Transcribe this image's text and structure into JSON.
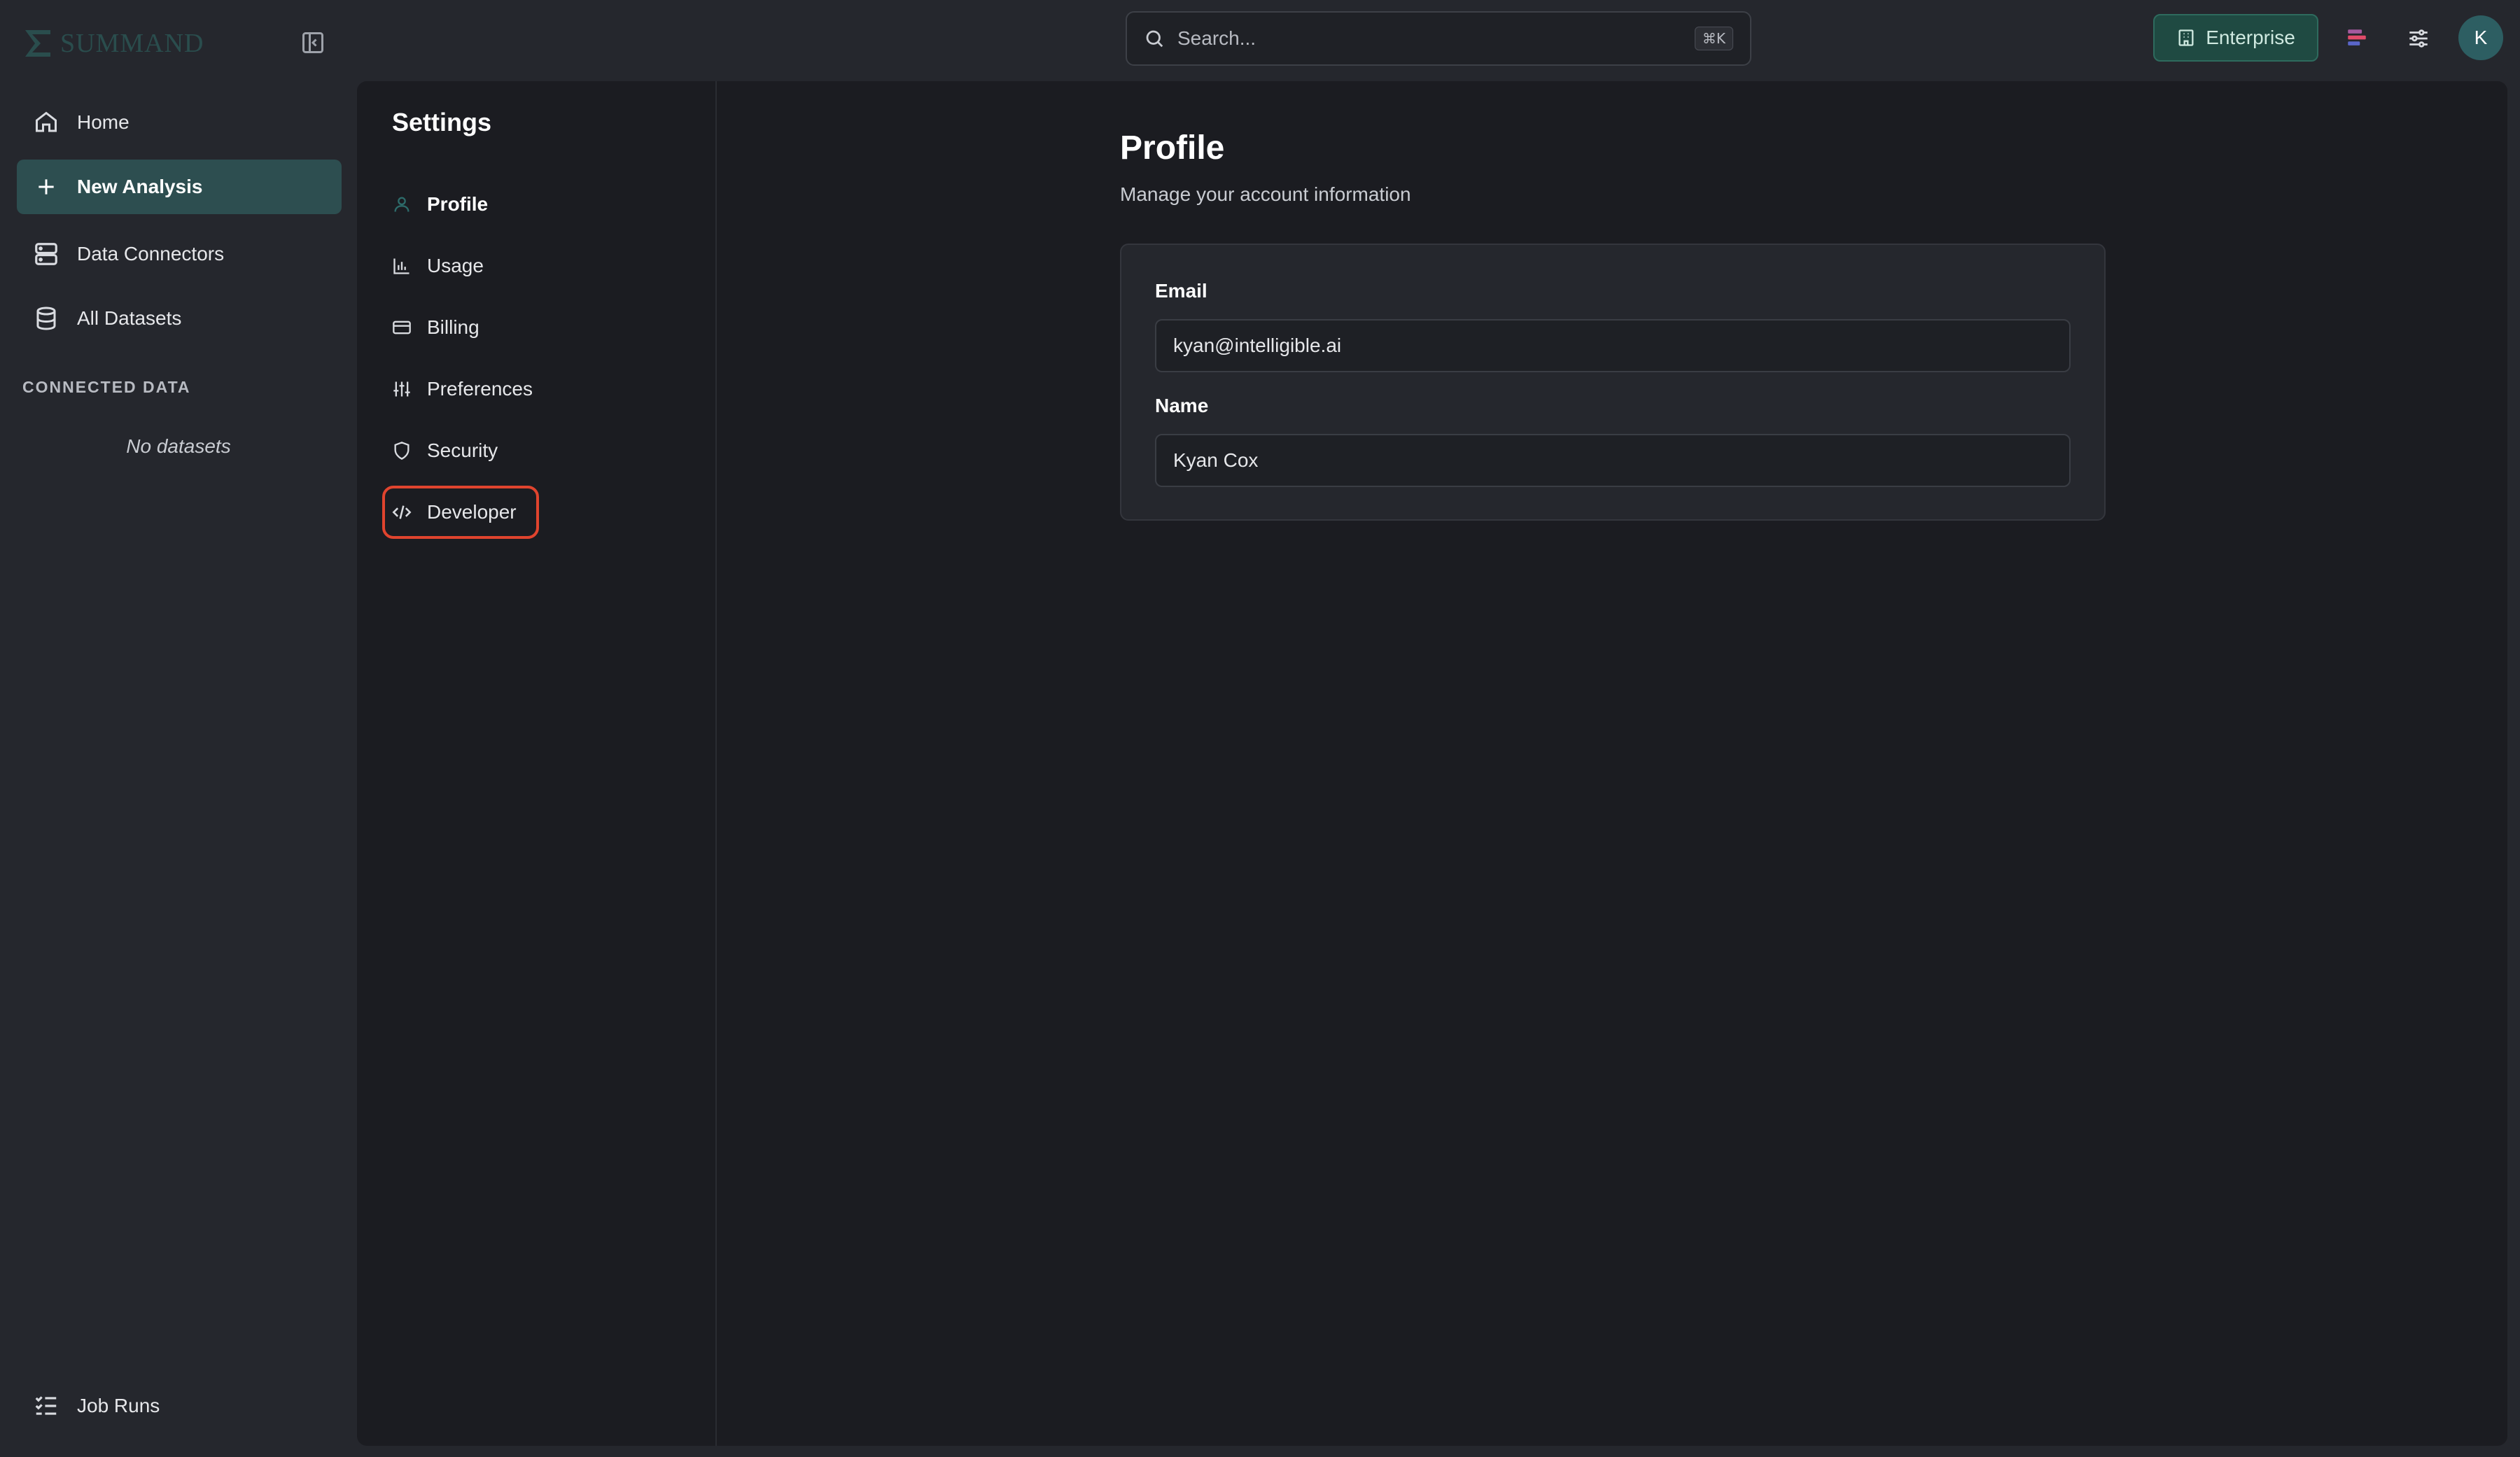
{
  "brand": {
    "name": "SUMMAND",
    "color": "#2a4d4d"
  },
  "sidebar": {
    "items": [
      {
        "label": "Home",
        "icon": "home-icon"
      },
      {
        "label": "New Analysis",
        "icon": "plus-icon",
        "active": true
      },
      {
        "label": "Data Connectors",
        "icon": "server-icon"
      },
      {
        "label": "All Datasets",
        "icon": "database-icon"
      }
    ],
    "section_label": "CONNECTED DATA",
    "empty_text": "No datasets",
    "footer_item": {
      "label": "Job Runs",
      "icon": "list-checks-icon"
    }
  },
  "topbar": {
    "search_placeholder": "Search...",
    "search_shortcut": "⌘K",
    "enterprise_label": "Enterprise",
    "avatar_initial": "K"
  },
  "settings": {
    "title": "Settings",
    "items": [
      {
        "label": "Profile",
        "icon": "user-icon",
        "active": true
      },
      {
        "label": "Usage",
        "icon": "bar-chart-icon"
      },
      {
        "label": "Billing",
        "icon": "credit-card-icon"
      },
      {
        "label": "Preferences",
        "icon": "sliders-icon"
      },
      {
        "label": "Security",
        "icon": "shield-icon"
      },
      {
        "label": "Developer",
        "icon": "code-icon",
        "highlighted": true
      }
    ]
  },
  "profile": {
    "title": "Profile",
    "subtitle": "Manage your account information",
    "email_label": "Email",
    "email_value": "kyan@intelligible.ai",
    "name_label": "Name",
    "name_value": "Kyan Cox"
  },
  "colors": {
    "accent": "#2d4e50",
    "highlight_border": "#e0442e",
    "enterprise_bg": "#1f4a42"
  }
}
